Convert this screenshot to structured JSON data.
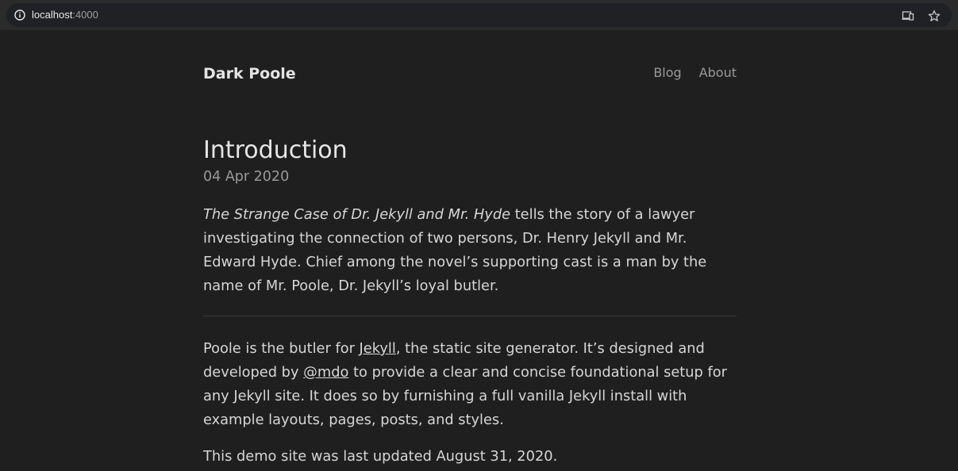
{
  "browser": {
    "url_host": "localhost",
    "url_port": ":4000",
    "icons": [
      "info-icon",
      "cast-icon",
      "star-icon"
    ]
  },
  "masthead": {
    "title": "Dark Poole",
    "nav": [
      {
        "label": "Blog"
      },
      {
        "label": "About"
      }
    ]
  },
  "post": {
    "title": "Introduction",
    "date": "04 Apr 2020",
    "intro": {
      "book_title": "The Strange Case of Dr. Jekyll and Mr. Hyde",
      "rest": " tells the story of a lawyer investigating the connection of two persons, Dr. Henry Jekyll and Mr. Edward Hyde. Chief among the novel’s supporting cast is a man by the name of Mr. Poole, Dr. Jekyll’s loyal butler."
    },
    "body": {
      "part1": "Poole is the butler for ",
      "link1": "Jekyll",
      "part2": ", the static site generator. It’s designed and developed by ",
      "link2": "@mdo",
      "part3": " to provide a clear and concise foundational setup for any Jekyll site. It does so by furnishing a full vanilla Jekyll install with example layouts, pages, posts, and styles."
    },
    "updated": "This demo site was last updated August 31, 2020."
  },
  "colors": {
    "page_background": "#1f1f1f",
    "text": "#d6d6d6",
    "muted": "#9a9a9a"
  }
}
